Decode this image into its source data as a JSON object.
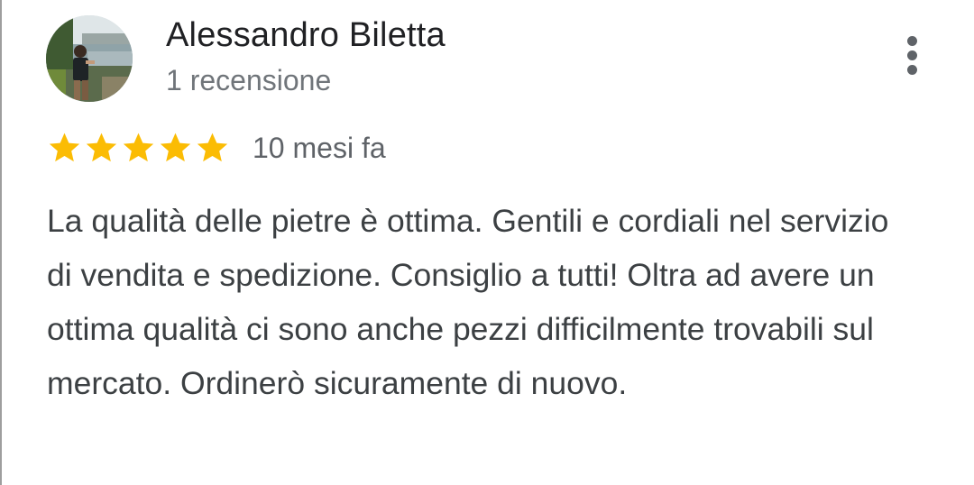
{
  "review": {
    "author": {
      "name": "Alessandro Biletta",
      "review_count": "1 recensione",
      "avatar_icon": "user-photo-avatar"
    },
    "rating": {
      "stars": 5,
      "max_stars": 5,
      "star_color": "#fbbc04",
      "star_icon": "star-icon"
    },
    "date": "10 mesi fa",
    "text": "La qualità delle pietre è ottima. Gentili e cordiali nel servizio di vendita e spedizione. Consiglio a tutti! Oltra ad avere un ottima qualità ci sono anche pezzi difficilmente trovabili sul mercato. Ordinerò sicuramente di nuovo.",
    "more_icon": "more-vert-icon"
  }
}
